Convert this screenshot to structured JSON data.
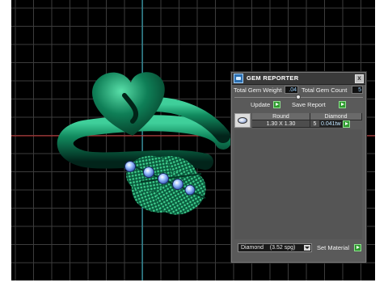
{
  "panel": {
    "title": "GEM REPORTER",
    "close_glyph": "x",
    "total_gem_weight_label": "Total Gem Weight",
    "total_gem_weight_value": ".04",
    "total_gem_count_label": "Total Gem Count",
    "total_gem_count_value": "5",
    "update_label": "Update",
    "save_report_label": "Save Report",
    "table": {
      "headers": [
        "Round",
        "Diamond"
      ],
      "row": {
        "size": "1.30 X 1.30",
        "count": "5",
        "weight": "0.041tw"
      }
    },
    "material_select_value": "Diamond    (3.52 spg)",
    "set_material_label": "Set Material"
  },
  "icons": [
    "gem-reporter-icon",
    "close-icon",
    "go-arrow-icon",
    "gem-thumbnail-icon",
    "dropdown-arrow-icon"
  ],
  "colors": {
    "viewport_bg": "#000000",
    "grid": "#3c3c3c",
    "axis_y": "#2fb4c8",
    "axis_x": "#c83030",
    "ring_green": "#0e7a55",
    "gem_blue": "#7fa8ff",
    "go_button": "#2f9a2f"
  }
}
